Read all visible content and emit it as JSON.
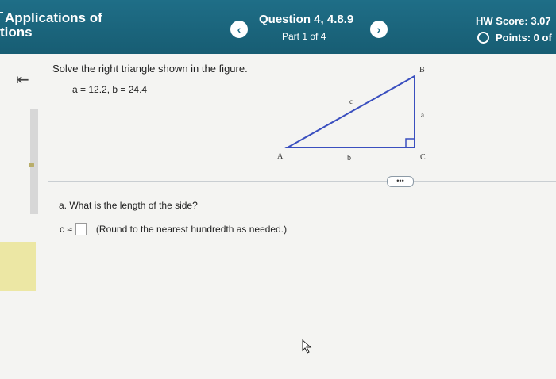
{
  "header": {
    "title_line1": "Applications of",
    "title_line2": "tions",
    "question": "Question 4, 4.8.9",
    "part": "Part 1 of 4",
    "hw_score": "HW Score: 3.07",
    "points": "Points: 0 of",
    "prev_icon": "chevron-left",
    "next_icon": "chevron-right"
  },
  "problem": {
    "prompt": "Solve the right triangle shown in the figure.",
    "given": "a = 12.2, b = 24.4"
  },
  "figure": {
    "label_A": "A",
    "label_B": "B",
    "label_C": "C",
    "label_a": "a",
    "label_b": "b",
    "label_c": "c"
  },
  "more_button": "•••",
  "part_a": {
    "question": "a. What is the length of the side?",
    "answer_prefix": "c ≈",
    "answer_value": "",
    "hint": "(Round to the nearest hundredth as needed.)"
  }
}
